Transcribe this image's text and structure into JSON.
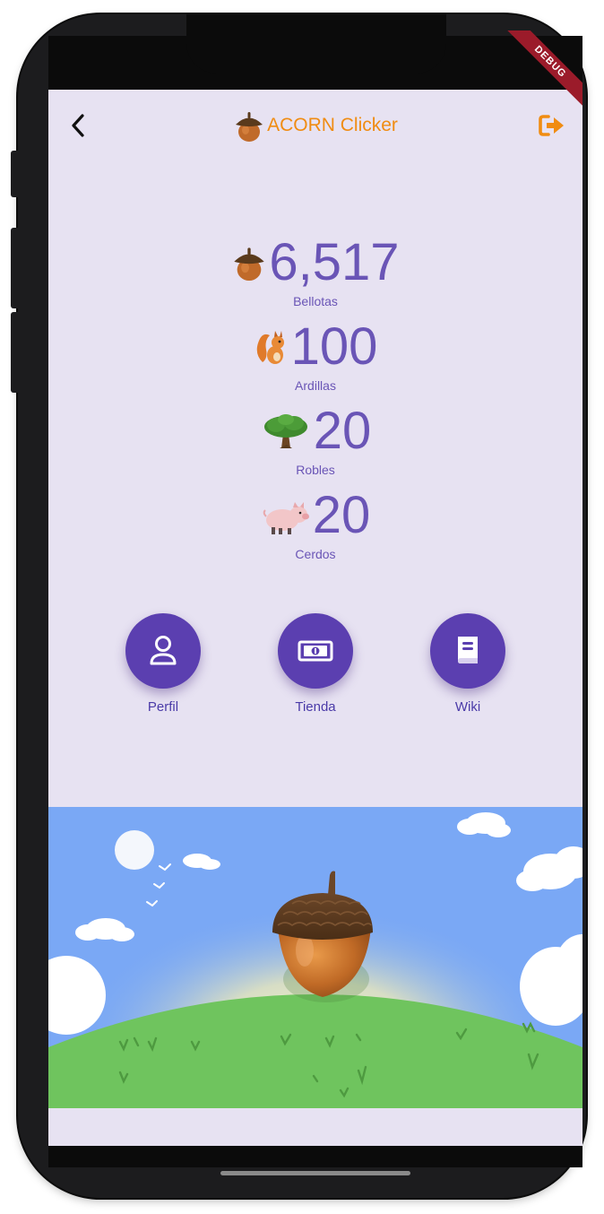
{
  "app_bar": {
    "title": "ACORN Clicker",
    "back_icon": "chevron-left-icon",
    "logout_icon": "logout-icon"
  },
  "debug_banner": "DEBUG",
  "stats": [
    {
      "icon": "acorn-icon",
      "value": "6,517",
      "label": "Bellotas"
    },
    {
      "icon": "squirrel-icon",
      "value": "100",
      "label": "Ardillas"
    },
    {
      "icon": "oak-tree-icon",
      "value": "20",
      "label": "Robles"
    },
    {
      "icon": "pig-icon",
      "value": "20",
      "label": "Cerdos"
    }
  ],
  "actions": [
    {
      "icon": "person-icon",
      "label": "Perfil"
    },
    {
      "icon": "money-icon",
      "label": "Tienda"
    },
    {
      "icon": "book-icon",
      "label": "Wiki"
    }
  ],
  "colors": {
    "accent": "#f08c12",
    "primary": "#5b3fb0",
    "text": "#6a55b6",
    "background": "#e7e2f2",
    "sky": "#7aa8f5",
    "grass": "#6fc45e"
  }
}
